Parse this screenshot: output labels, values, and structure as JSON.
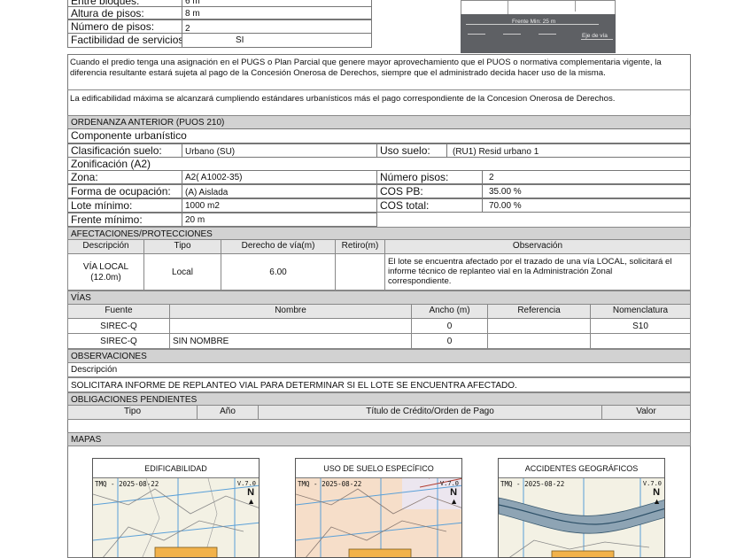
{
  "top_rows": [
    {
      "label": "Entre bloques:",
      "value": "6 m"
    },
    {
      "label": "Altura de pisos:",
      "value": "8 m"
    },
    {
      "label": "Número de pisos:",
      "value": "2"
    },
    {
      "label": "Factibilidad de servicios",
      "value": "SI"
    }
  ],
  "diagram": {
    "frente_label": "Frente Min: 25 m",
    "eje_label": "Eje de vía"
  },
  "notes": {
    "pugs": "Cuando el predio tenga una asignación en el PUGS o Plan Parcial que genere mayor aprovechamiento que el PUOS o normativa complementaria vigente, la diferencia resultante estará sujeta al pago de la Concesión Onerosa de Derechos, siempre que el administrado decida hacer uso de la misma.",
    "edificabilidad": "La edificabilidad máxima se alcanzará cumpliendo estándares urbanísticos más el pago correspondiente de la Concesion Onerosa de Derechos."
  },
  "ordenanza": {
    "header": "ORDENANZA ANTERIOR (PUOS 210)",
    "componente": "Componente urbanístico",
    "clasificacion_label": "Clasificación suelo:",
    "clasificacion_value": "Urbano (SU)",
    "uso_label": "Uso suelo:",
    "uso_value": "(RU1) Resid urbano 1",
    "zonificacion": "Zonificación (A2)",
    "zona_label": "Zona:",
    "zona_value": "A2( A1002-35)",
    "pisos_label": "Número pisos:",
    "pisos_value": "2",
    "forma_label": "Forma de ocupación:",
    "forma_value": "(A) Aislada",
    "cospb_label": "COS PB:",
    "cospb_value": "35.00 %",
    "lote_label": "Lote mínimo:",
    "lote_value": "1000 m2",
    "costotal_label": "COS total:",
    "costotal_value": "70.00 %",
    "frente_label": "Frente mínimo:",
    "frente_value": "20 m"
  },
  "afectaciones": {
    "header": "AFECTACIONES/PROTECCIONES",
    "columns": [
      "Descripción",
      "Tipo",
      "Derecho de vía(m)",
      "Retiro(m)",
      "Observación"
    ],
    "row": {
      "descripcion_1": "VÍA LOCAL",
      "descripcion_2": "(12.0m)",
      "tipo": "Local",
      "derecho": "6.00",
      "retiro": "",
      "observacion_1": "El lote se encuentra afectado por el trazado de una vía LOCAL, solicitará el",
      "observacion_2": "informe técnico de replanteo vial en la Administración Zonal",
      "observacion_3": "correspondiente."
    }
  },
  "vias": {
    "header": "VÍAS",
    "columns": [
      "Fuente",
      "Nombre",
      "Ancho (m)",
      "Referencia",
      "Nomenclatura"
    ],
    "rows": [
      {
        "fuente": "SIREC-Q",
        "nombre": "",
        "ancho": "0",
        "referencia": "",
        "nomenclatura": "S10"
      },
      {
        "fuente": "SIREC-Q",
        "nombre": "SIN NOMBRE",
        "ancho": "0",
        "referencia": "",
        "nomenclatura": ""
      }
    ]
  },
  "observaciones": {
    "header": "OBSERVACIONES",
    "descripcion": "Descripción",
    "text": "SOLICITARA INFORME DE REPLANTEO VIAL PARA DETERMINAR SI EL LOTE SE ENCUENTRA AFECTADO."
  },
  "obligaciones": {
    "header": "OBLIGACIONES PENDIENTES",
    "columns": [
      "Tipo",
      "Año",
      "Título de Crédito/Orden de Pago",
      "Valor"
    ]
  },
  "mapas": {
    "header": "MAPAS",
    "maps": [
      {
        "title": "EDIFICABILIDAD",
        "stamp": "TMQ - 2025-08-22",
        "version": "V.7.0",
        "north": "N"
      },
      {
        "title": "USO DE SUELO ESPECÍFICO",
        "stamp": "TMQ - 2025-08-22",
        "version": "V.7.0",
        "north": "N"
      },
      {
        "title": "ACCIDENTES GEOGRÁFICOS",
        "stamp": "TMQ - 2025-08-22",
        "version": "V.7.0",
        "north": "N"
      }
    ]
  }
}
